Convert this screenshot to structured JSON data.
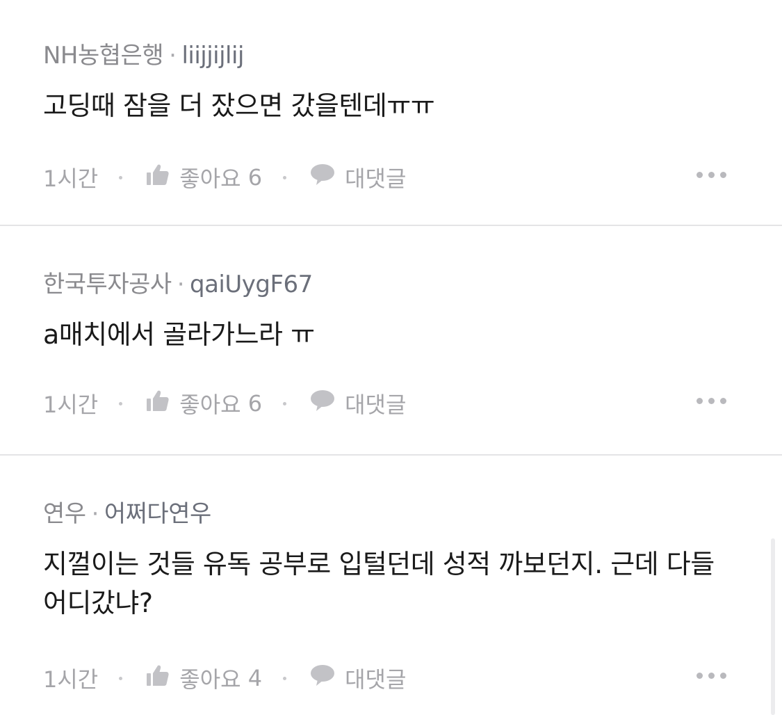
{
  "comments": [
    {
      "source": "NH농협은행",
      "nickname": "liijjijlij",
      "text": "고딩때 잠을 더 잤으면 갔을텐데ㅠㅠ",
      "time": "1시간",
      "like_label": "좋아요",
      "like_count": "6",
      "reply_label": "대댓글"
    },
    {
      "source": "한국투자공사",
      "nickname": "qaiUygF67",
      "text": "a매치에서 골라가느라 ㅠ",
      "time": "1시간",
      "like_label": "좋아요",
      "like_count": "6",
      "reply_label": "대댓글"
    },
    {
      "source": "연우",
      "nickname": "어쩌다연우",
      "text": "지껄이는 것들 유독 공부로 입털던데 성적 까보던지. 근데 다들 어디갔냐?",
      "time": "1시간",
      "like_label": "좋아요",
      "like_count": "4",
      "reply_label": "대댓글"
    }
  ],
  "separator": "·",
  "icons": {
    "like": "thumbs-up-icon",
    "reply": "speech-bubble-icon",
    "more": "more-horizontal-icon"
  },
  "colors": {
    "background": "#ffffff",
    "text_primary": "#1a1a1a",
    "text_meta": "#8a8a8e",
    "text_action": "#a5a5a9",
    "icon": "#c2c2c6",
    "divider": "#e4e4e6"
  }
}
